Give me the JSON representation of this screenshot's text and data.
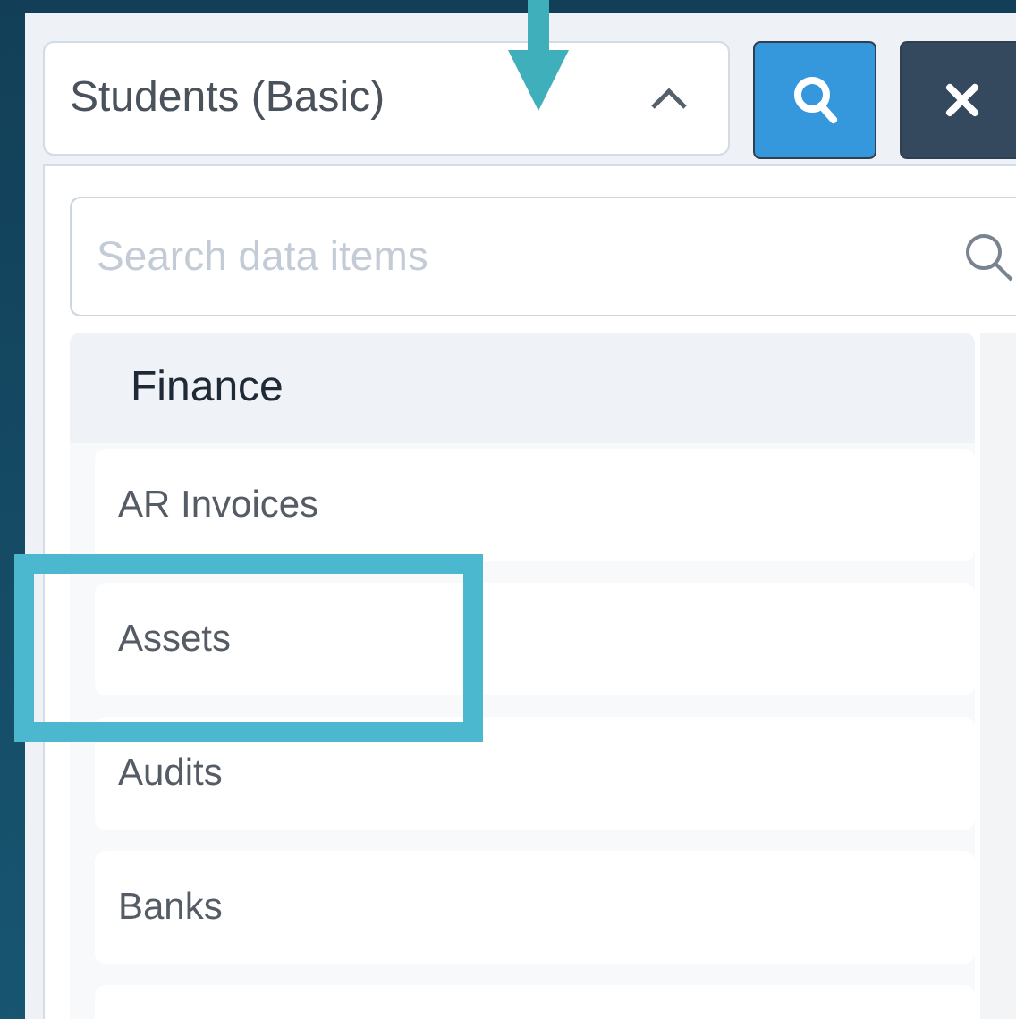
{
  "dropdown": {
    "value": "Students (Basic)",
    "expanded": true
  },
  "search": {
    "placeholder": "Search data items"
  },
  "group": {
    "title": "Finance",
    "items": [
      {
        "label": "AR Invoices",
        "highlighted": false
      },
      {
        "label": "Assets",
        "highlighted": true
      },
      {
        "label": "Audits",
        "highlighted": false
      },
      {
        "label": "Banks",
        "highlighted": false
      }
    ]
  },
  "annotations": [
    {
      "kind": "arrow"
    }
  ]
}
